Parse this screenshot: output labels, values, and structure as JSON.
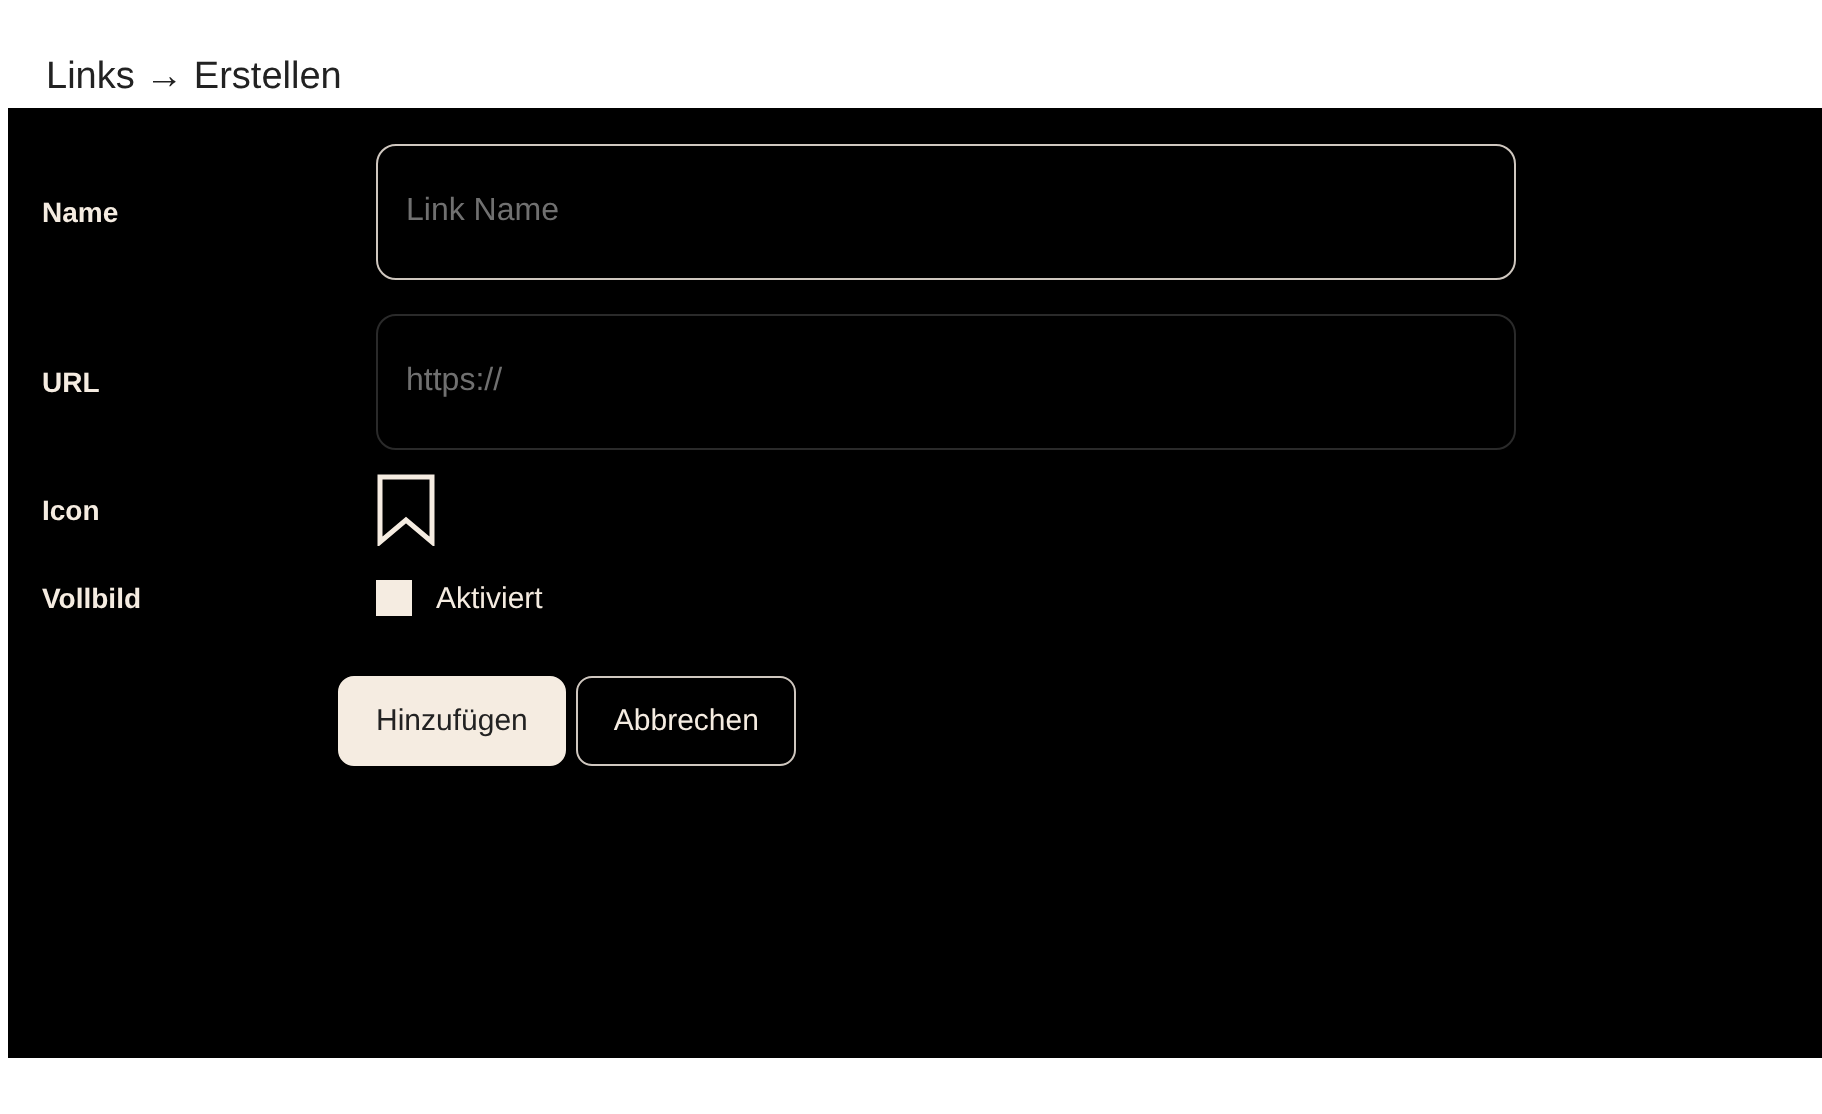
{
  "breadcrumb": "Links → Erstellen",
  "fields": [
    {
      "label": "Name",
      "placeholder": "Link Name",
      "focused": true
    },
    {
      "label": "URL",
      "placeholder": "https://",
      "focused": false
    }
  ],
  "icon_row": {
    "label": "Icon"
  },
  "fullscreen": {
    "label": "Vollbild",
    "option": "Aktiviert",
    "checked": false
  },
  "buttons": [
    {
      "label": "Hinzufügen",
      "kind": "primary"
    },
    {
      "label": "Abbrechen",
      "kind": "secondary"
    }
  ]
}
